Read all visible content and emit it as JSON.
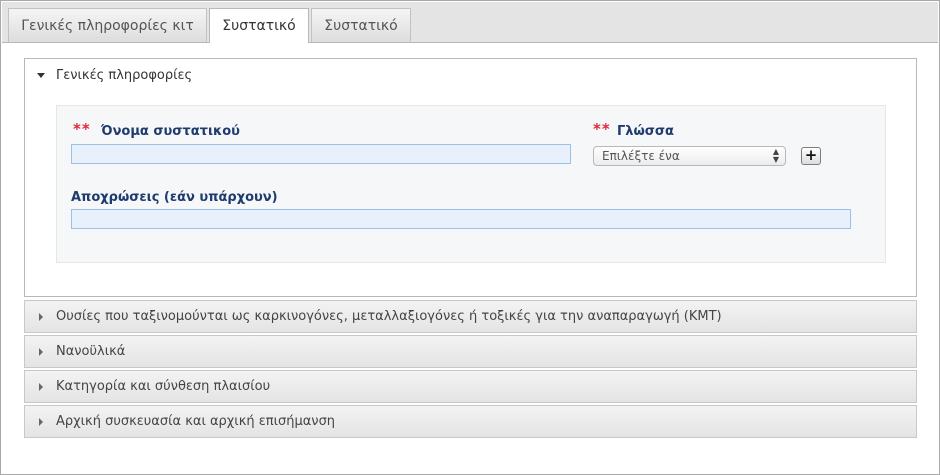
{
  "tabs": [
    {
      "label": "Γενικές πληροφορίες κιτ",
      "active": false
    },
    {
      "label": "Συστατικό",
      "active": true
    },
    {
      "label": "Συστατικό",
      "active": false
    }
  ],
  "general_section": {
    "title": "Γενικές πληροφορίες",
    "required_marker": "**",
    "ingredient_name": {
      "label": "Όνομα συστατικού",
      "value": "",
      "placeholder": ""
    },
    "language": {
      "label": "Γλώσσα",
      "selected": "Επιλέξτε ένα",
      "add_label": "+"
    },
    "shades": {
      "label": "Αποχρώσεις (εάν υπάρχουν)",
      "value": "",
      "placeholder": ""
    }
  },
  "collapsed_sections": [
    {
      "label": "Ουσίες που ταξινομούνται ως καρκινογόνες, μεταλλαξιογόνες ή τοξικές για την αναπαραγωγή (ΚΜΤ)"
    },
    {
      "label": "Νανοϋλικά"
    },
    {
      "label": "Κατηγορία και σύνθεση πλαισίου"
    },
    {
      "label": "Αρχική συσκευασία και αρχική επισήμανση"
    }
  ]
}
